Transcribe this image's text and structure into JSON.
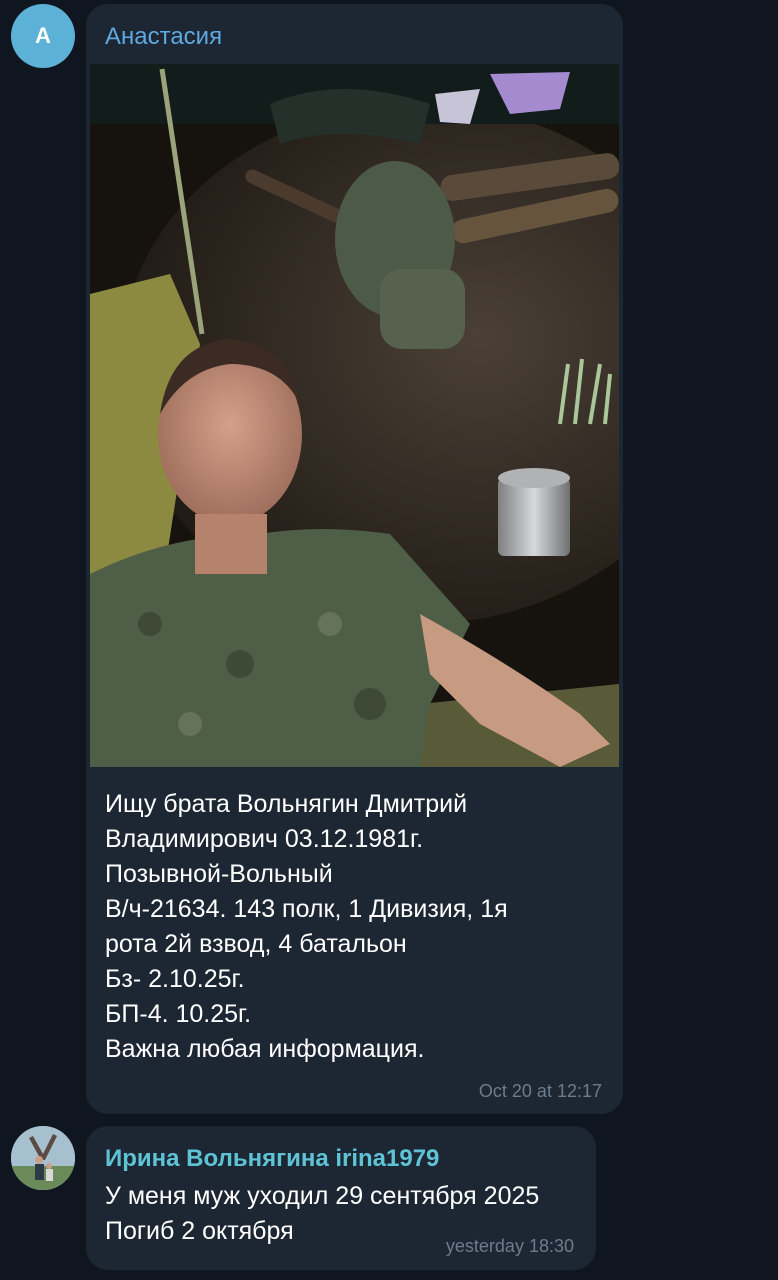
{
  "message_1": {
    "avatar_letter": "А",
    "sender": "Анастасия",
    "photo_description_icon": "selfie-photo",
    "text_lines": [
      "Ищу брата Вольнягин Дмитрий",
      "Владимирович 03.12.1981г.",
      "Позывной-Вольный",
      "В/ч-21634. 143 полк, 1 Дивизия, 1я",
      "рота 2й взвод, 4 батальон",
      "Бз- 2.10.25г.",
      "БП-4. 10.25г.",
      "Важна любая информация."
    ],
    "time": "Oct 20 at 12:17"
  },
  "message_2": {
    "avatar_icon": "user-photo-avatar",
    "sender": "Ирина Вольнягина irina1979",
    "text_lines": [
      "У меня муж уходил 29 сентября 2025",
      "Погиб 2 октября"
    ],
    "time": "yesterday 18:30"
  },
  "colors": {
    "background": "#0f161f",
    "bubble": "#1d2733",
    "sender_1": "#5fa9e0",
    "sender_2": "#5fc3d6",
    "timestamp": "#6b7c8e",
    "avatar_letter_bg": "#5cb2d6"
  }
}
